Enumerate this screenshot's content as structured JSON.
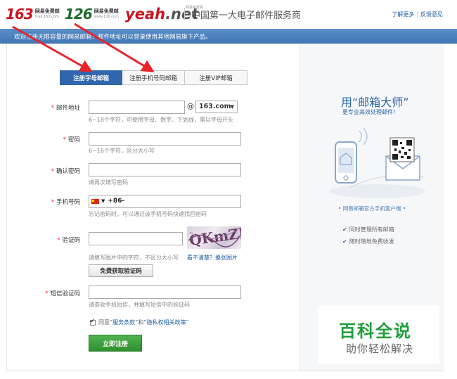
{
  "header": {
    "logo_163": {
      "num": "163",
      "line1": "网易免费邮",
      "line2": "mail.163.com"
    },
    "logo_126": {
      "num": "126",
      "line1": "网易免费邮",
      "line2": "www.126.com"
    },
    "logo_yeah": {
      "text1": "yeah",
      "text2": ".net",
      "tiny": "网易免费邮"
    },
    "slogan": "中国第一大电子邮件服务商",
    "link_more": "了解更多",
    "link_feedback": "反馈意见"
  },
  "bluebar": {
    "text": "欢迎注册无限容量的网易邮箱！邮件地址可以登录使用其他网易旗下产品。"
  },
  "tabs": [
    {
      "label": "注册字母邮箱",
      "active": true
    },
    {
      "label": "注册手机号码邮箱",
      "active": false
    },
    {
      "label": "注册VIP邮箱",
      "active": false
    }
  ],
  "form": {
    "email": {
      "label": "邮件地址",
      "value": "",
      "at": "@",
      "domain": "163.com",
      "hint": "6~18个字符，可使用字母、数字、下划线，需以字母开头"
    },
    "password": {
      "label": "密码",
      "value": "",
      "hint": "6~16个字符，区分大小写"
    },
    "confirm": {
      "label": "确认密码",
      "value": "",
      "hint": "请再次填写密码"
    },
    "phone": {
      "label": "手机号码",
      "prefix": "+86-",
      "hint": "忘记密码时，可以通过该手机号码快速找回密码"
    },
    "captcha": {
      "label": "验证码",
      "value": "",
      "hint": "请填写图片中的字符，不区分大小写",
      "refresh": "看不清楚？换张图片",
      "image_text": "QKmZK"
    },
    "free_button": "免费获取验证码",
    "sms": {
      "label": "短信验证码",
      "value": "",
      "hint": "请查收手机短信，并填写短信中的验证码"
    },
    "agree": {
      "prefix": "同意",
      "terms": "“服务条款”",
      "and": "和",
      "privacy": "“隐私权相关政策”",
      "checked": true
    },
    "submit": "立即注册"
  },
  "right": {
    "title": "用“邮箱大师”",
    "subtitle": "更专业高效处理邮件！",
    "client": "• 网易邮箱官方手机客户端 •",
    "features": [
      "同时管理所有邮箱",
      "随时随地免费收发"
    ]
  },
  "watermark": {
    "line1": "百科全说",
    "line2": "助你轻松解决"
  },
  "colors": {
    "brand_blue": "#2f66ad",
    "red": "#c8141f",
    "green": "#2f8f2f",
    "arrow": "#e8232b"
  }
}
